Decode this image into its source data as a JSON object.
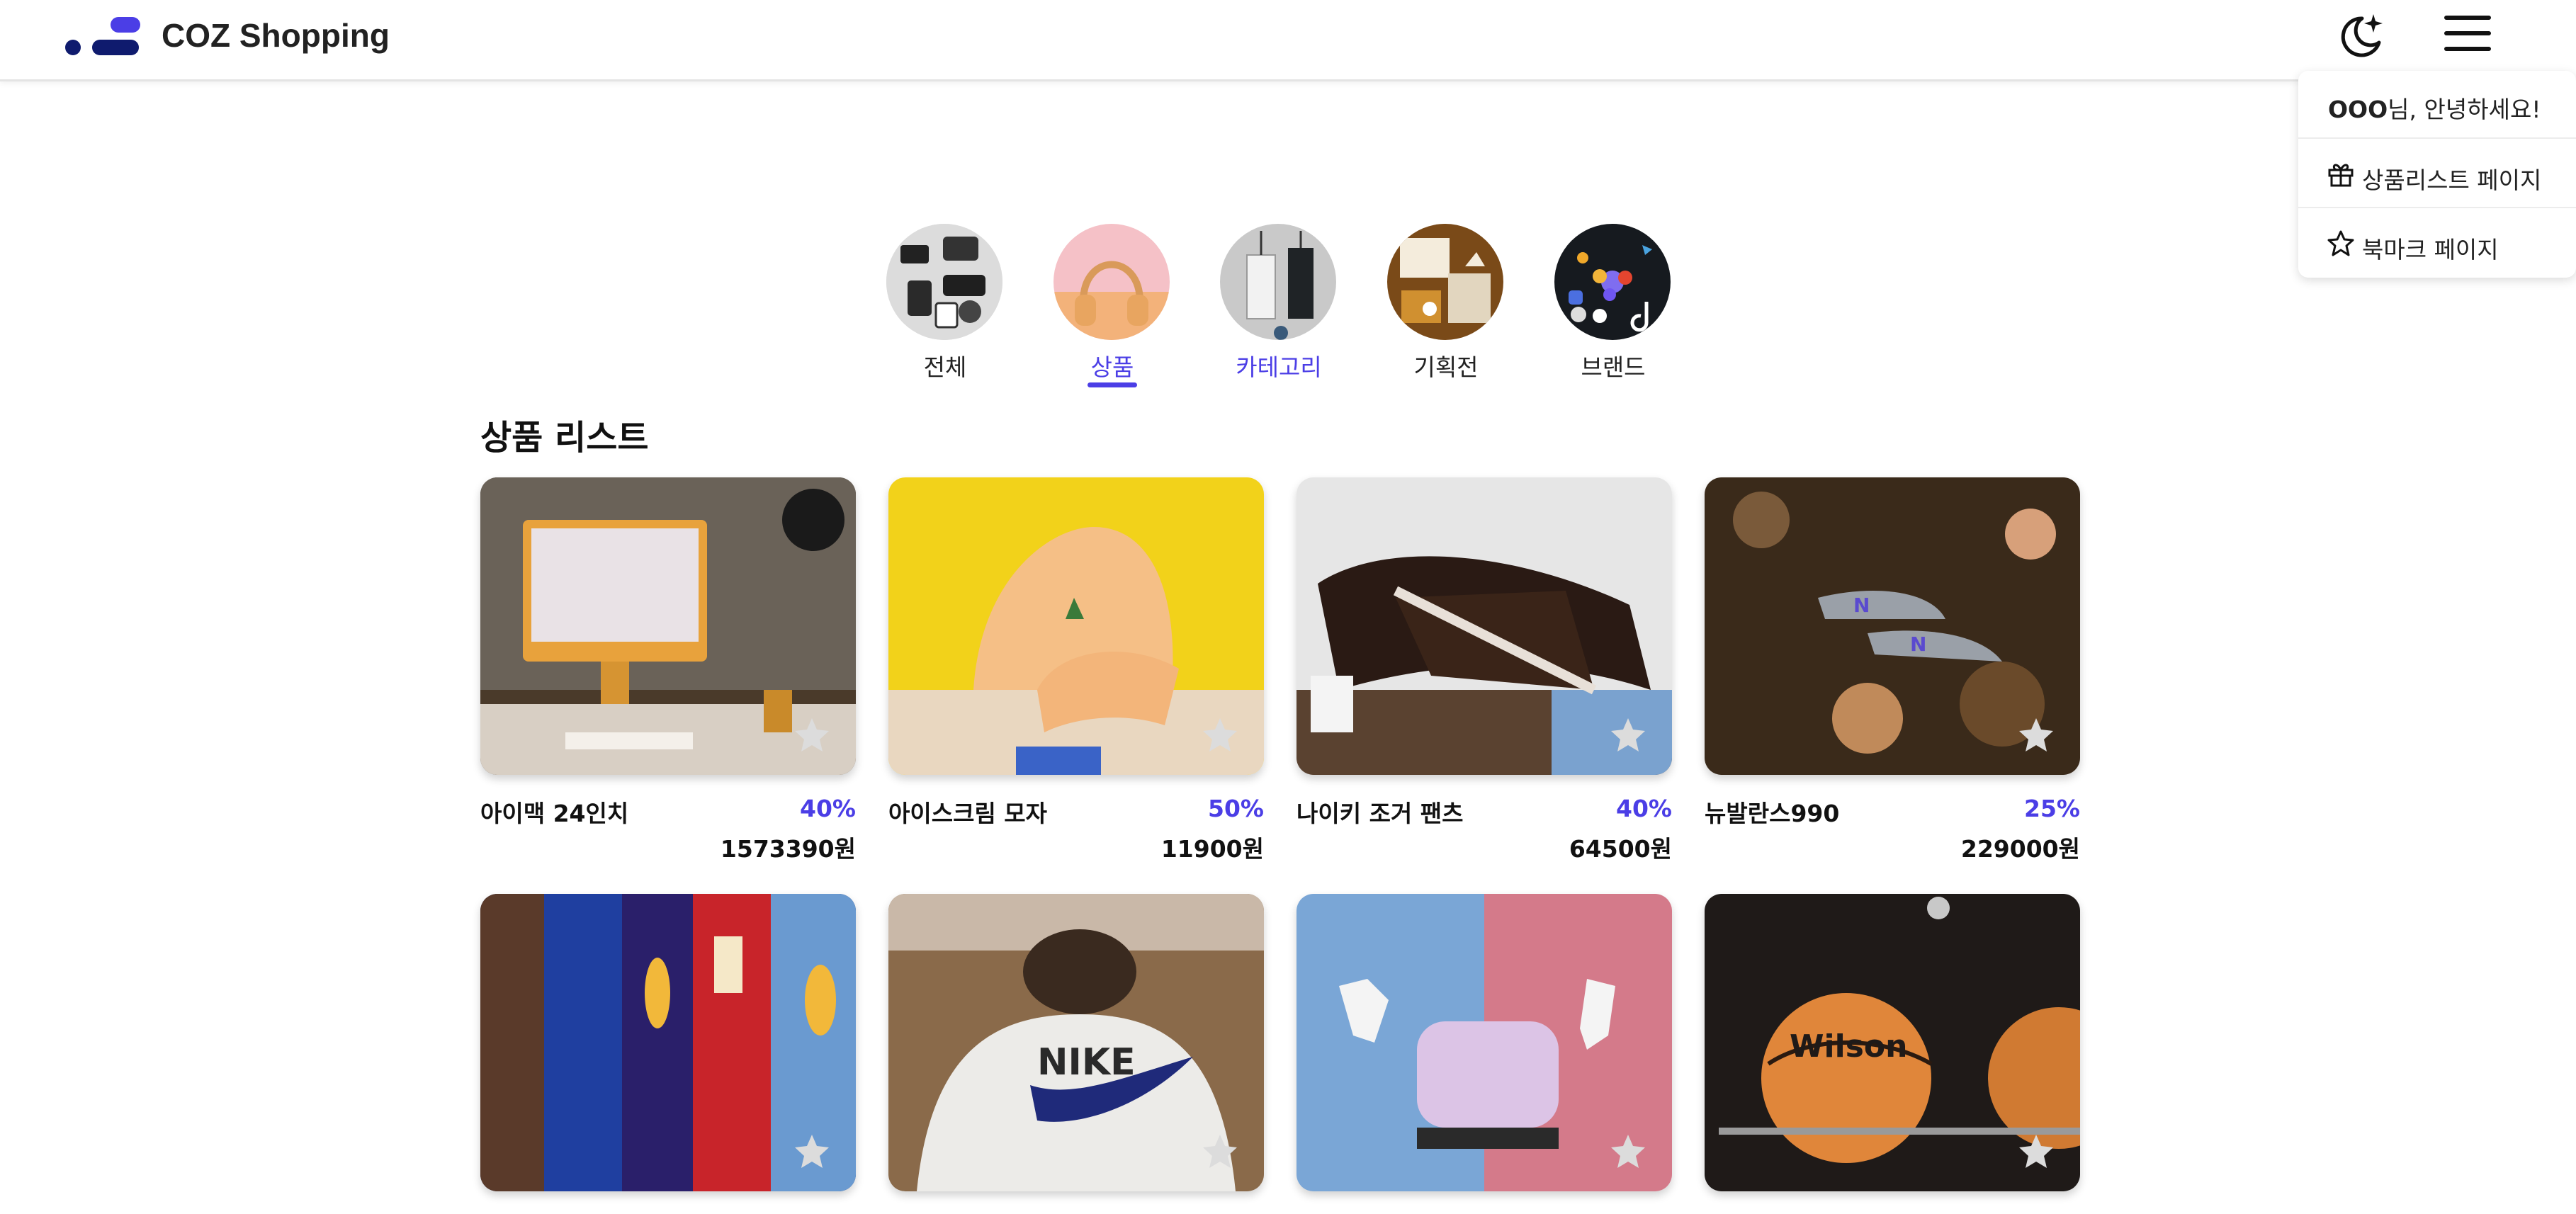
{
  "header": {
    "brand": "COZ Shopping",
    "logo_icon": "logo-icon",
    "theme_icon": "moon-sparkle-icon",
    "menu_icon": "hamburger-icon",
    "colors": {
      "primary": "#4b3ee6",
      "navy": "#0f1b6e"
    }
  },
  "dropdown": {
    "user_name": "OOO",
    "greeting_suffix": "님, 안녕하세요!",
    "items": [
      {
        "label": "상품리스트 페이지",
        "icon": "gift-icon"
      },
      {
        "label": "북마크 페이지",
        "icon": "star-outline-icon"
      }
    ]
  },
  "categories": [
    {
      "label": "전체",
      "active": false
    },
    {
      "label": "상품",
      "active": true
    },
    {
      "label": "카테고리",
      "active": false
    },
    {
      "label": "기획전",
      "active": false
    },
    {
      "label": "브랜드",
      "active": false
    }
  ],
  "section": {
    "title": "상품 리스트"
  },
  "products": [
    {
      "name": "아이맥 24인치",
      "discount": "40%",
      "price": "1573390원"
    },
    {
      "name": "아이스크림 모자",
      "discount": "50%",
      "price": "11900원"
    },
    {
      "name": "나이키 조거 팬츠",
      "discount": "40%",
      "price": "64500원"
    },
    {
      "name": "뉴발란스990",
      "discount": "25%",
      "price": "229000원"
    },
    {
      "name": "",
      "discount": "",
      "price": ""
    },
    {
      "name": "",
      "discount": "",
      "price": ""
    },
    {
      "name": "",
      "discount": "",
      "price": ""
    },
    {
      "name": "",
      "discount": "",
      "price": ""
    }
  ]
}
